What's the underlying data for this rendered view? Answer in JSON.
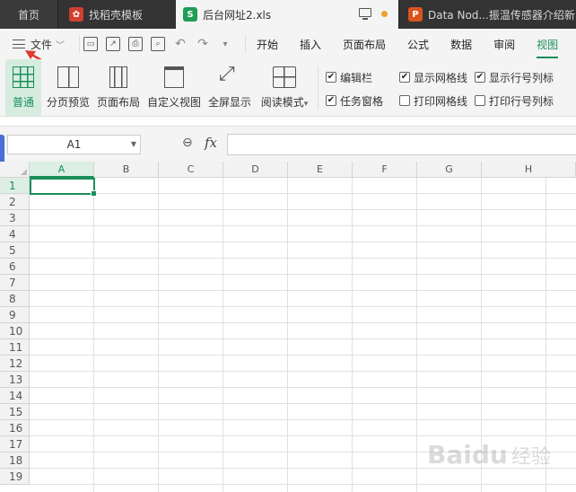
{
  "tabs": {
    "home": "首页",
    "template": "找稻壳模板",
    "active_file": "后台网址2.xls",
    "other_doc": "Data Nod...振温传感器介绍新",
    "icons": {
      "template": "docer-logo-icon",
      "active_file": "wps-spreadsheet-icon",
      "other_doc": "wps-presentation-icon"
    }
  },
  "menubar": {
    "file_label": "文件",
    "items": [
      "开始",
      "插入",
      "页面布局",
      "公式",
      "数据",
      "审阅",
      "视图"
    ],
    "active": "视图"
  },
  "toolbar": {
    "buttons": [
      "普通",
      "分页预览",
      "页面布局",
      "自定义视图",
      "全屏显示",
      "阅读模式"
    ],
    "read_mode_dropdown": "▾",
    "checks": [
      {
        "label": "编辑栏",
        "checked": true
      },
      {
        "label": "显示网格线",
        "checked": true
      },
      {
        "label": "显示行号列标",
        "checked": true
      },
      {
        "label": "任务窗格",
        "checked": true
      },
      {
        "label": "打印网格线",
        "checked": false
      },
      {
        "label": "打印行号列标",
        "checked": false
      }
    ]
  },
  "formula": {
    "cell_ref": "A1",
    "fx_label": "fx",
    "value": ""
  },
  "sheet": {
    "columns": [
      "A",
      "B",
      "C",
      "D",
      "E",
      "F",
      "G",
      "H"
    ],
    "rows": [
      "1",
      "2",
      "3",
      "4",
      "5",
      "6",
      "7",
      "8",
      "9",
      "10",
      "11",
      "12",
      "13",
      "14",
      "15",
      "16",
      "17",
      "18",
      "19"
    ],
    "active_cell": "A1"
  },
  "colors": {
    "accent": "#1a8f5a",
    "annotation_arrow": "#e03a2f"
  },
  "watermark": "Baidu 经验"
}
